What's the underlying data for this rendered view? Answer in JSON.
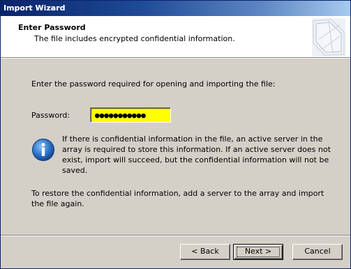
{
  "window": {
    "title": "Import Wizard"
  },
  "header": {
    "title": "Enter Password",
    "subtitle": "The file includes encrypted confidential information."
  },
  "body": {
    "prompt": "Enter the password required for opening and importing the file:",
    "password_label": "Password:",
    "password_value": "●●●●●●●●●●●",
    "info_text": "If there is confidential information in the file, an active server in the array is required to store this information. If an active server does not exist, import will succeed, but the confidential information will not be saved.",
    "restore_text": "To restore the confidential information, add a server to the array and import the file again."
  },
  "buttons": {
    "back": "< Back",
    "next": "Next >",
    "cancel": "Cancel"
  },
  "colors": {
    "titlebar_start": "#0a246a",
    "titlebar_end": "#a6caf0",
    "dialog_bg": "#d4d0c8",
    "password_field_bg": "#ffff00",
    "info_icon": "#1f5fb4"
  },
  "icons": {
    "header": "wizard-graphic-icon",
    "info": "info-icon"
  }
}
